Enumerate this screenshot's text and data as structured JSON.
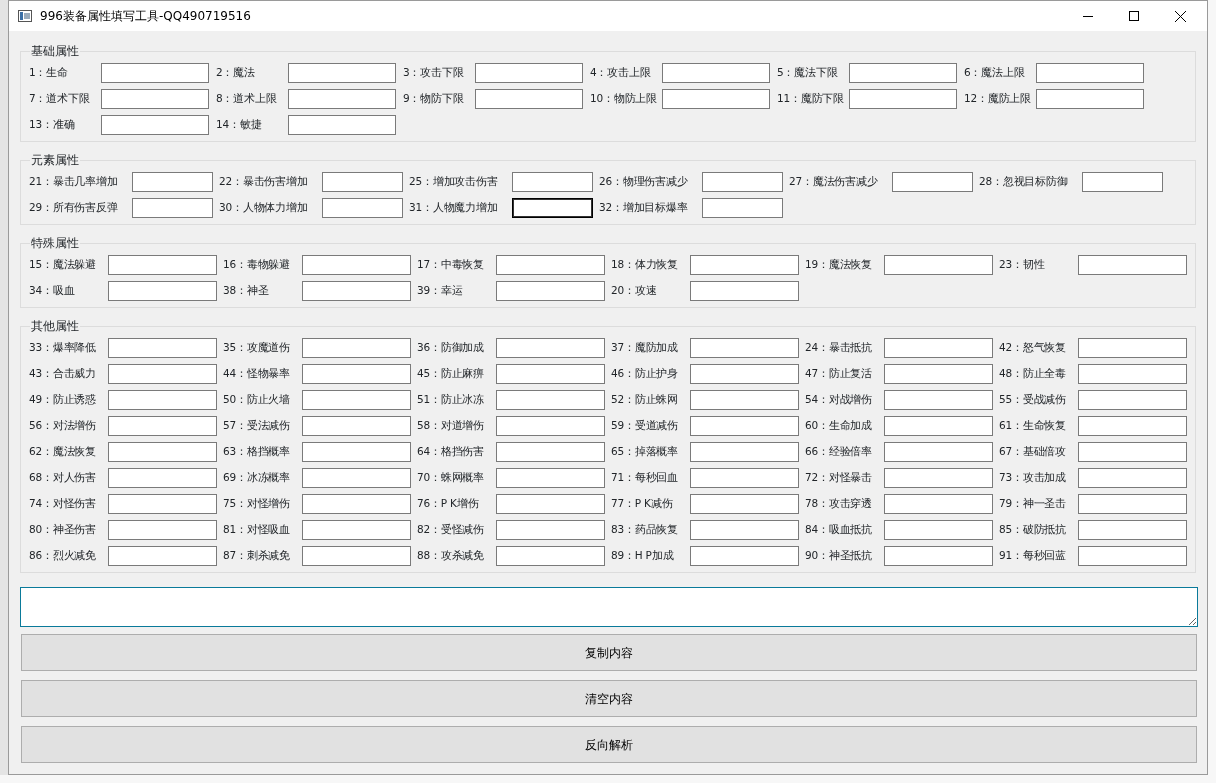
{
  "window": {
    "title": "996装备属性填写工具-QQ490719516"
  },
  "groups": [
    {
      "title": "基础属性",
      "fields": [
        {
          "label": "1：生命",
          "focused": false
        },
        {
          "label": "2：魔法",
          "focused": false
        },
        {
          "label": "3：攻击下限",
          "focused": false
        },
        {
          "label": "4：攻击上限",
          "focused": false
        },
        {
          "label": "5：魔法下限",
          "focused": false
        },
        {
          "label": "6：魔法上限",
          "focused": false
        },
        {
          "label": "7：道术下限",
          "focused": false
        },
        {
          "label": "8：道术上限",
          "focused": false
        },
        {
          "label": "9：物防下限",
          "focused": false
        },
        {
          "label": "10：物防上限",
          "focused": false
        },
        {
          "label": "11：魔防下限",
          "focused": false
        },
        {
          "label": "12：魔防上限",
          "focused": false
        },
        {
          "label": "13：准确",
          "focused": false
        },
        {
          "label": "14：敏捷",
          "focused": false
        }
      ]
    },
    {
      "title": "元素属性",
      "fields": [
        {
          "label": "21：暴击几率增加",
          "focused": false
        },
        {
          "label": "22：暴击伤害增加",
          "focused": false
        },
        {
          "label": "25：增加攻击伤害",
          "focused": false
        },
        {
          "label": "26：物理伤害减少",
          "focused": false
        },
        {
          "label": "27：魔法伤害减少",
          "focused": false
        },
        {
          "label": "28：忽视目标防御",
          "focused": false
        },
        {
          "label": "29：所有伤害反弹",
          "focused": false
        },
        {
          "label": "30：人物体力增加",
          "focused": false
        },
        {
          "label": "31：人物魔力增加",
          "focused": true
        },
        {
          "label": "32：增加目标爆率",
          "focused": false
        }
      ]
    },
    {
      "title": "特殊属性",
      "fields": [
        {
          "label": "15：魔法躲避",
          "focused": false
        },
        {
          "label": "16：毒物躲避",
          "focused": false
        },
        {
          "label": "17：中毒恢复",
          "focused": false
        },
        {
          "label": "18：体力恢复",
          "focused": false
        },
        {
          "label": "19：魔法恢复",
          "focused": false
        },
        {
          "label": "23：韧性",
          "focused": false
        },
        {
          "label": "34：吸血",
          "focused": false
        },
        {
          "label": "38：神圣",
          "focused": false
        },
        {
          "label": "39：幸运",
          "focused": false
        },
        {
          "label": "20：攻速",
          "focused": false
        }
      ]
    },
    {
      "title": "其他属性",
      "fields": [
        {
          "label": "33：爆率降低",
          "focused": false
        },
        {
          "label": "35：攻魔道伤",
          "focused": false
        },
        {
          "label": "36：防御加成",
          "focused": false
        },
        {
          "label": "37：魔防加成",
          "focused": false
        },
        {
          "label": "24：暴击抵抗",
          "focused": false
        },
        {
          "label": "42：怒气恢复",
          "focused": false
        },
        {
          "label": "43：合击威力",
          "focused": false
        },
        {
          "label": "44：怪物暴率",
          "focused": false
        },
        {
          "label": "45：防止麻痹",
          "focused": false
        },
        {
          "label": "46：防止护身",
          "focused": false
        },
        {
          "label": "47：防止复活",
          "focused": false
        },
        {
          "label": "48：防止全毒",
          "focused": false
        },
        {
          "label": "49：防止诱惑",
          "focused": false
        },
        {
          "label": "50：防止火墙",
          "focused": false
        },
        {
          "label": "51：防止冰冻",
          "focused": false
        },
        {
          "label": "52：防止蛛网",
          "focused": false
        },
        {
          "label": "54：对战增伤",
          "focused": false
        },
        {
          "label": "55：受战减伤",
          "focused": false
        },
        {
          "label": "56：对法增伤",
          "focused": false
        },
        {
          "label": "57：受法减伤",
          "focused": false
        },
        {
          "label": "58：对道增伤",
          "focused": false
        },
        {
          "label": "59：受道减伤",
          "focused": false
        },
        {
          "label": "60：生命加成",
          "focused": false
        },
        {
          "label": "61：生命恢复",
          "focused": false
        },
        {
          "label": "62：魔法恢复",
          "focused": false
        },
        {
          "label": "63：格挡概率",
          "focused": false
        },
        {
          "label": "64：格挡伤害",
          "focused": false
        },
        {
          "label": "65：掉落概率",
          "focused": false
        },
        {
          "label": "66：经验倍率",
          "focused": false
        },
        {
          "label": "67：基础倍攻",
          "focused": false
        },
        {
          "label": "68：对人伤害",
          "focused": false
        },
        {
          "label": "69：冰冻概率",
          "focused": false
        },
        {
          "label": "70：蛛网概率",
          "focused": false
        },
        {
          "label": "71：每秒回血",
          "focused": false
        },
        {
          "label": "72：对怪暴击",
          "focused": false
        },
        {
          "label": "73：攻击加成",
          "focused": false
        },
        {
          "label": "74：对怪伤害",
          "focused": false
        },
        {
          "label": "75：对怪增伤",
          "focused": false
        },
        {
          "label": "76：P K增伤",
          "focused": false
        },
        {
          "label": "77：P K减伤",
          "focused": false
        },
        {
          "label": "78：攻击穿透",
          "focused": false
        },
        {
          "label": "79：神一圣击",
          "focused": false
        },
        {
          "label": "80：神圣伤害",
          "focused": false
        },
        {
          "label": "81：对怪吸血",
          "focused": false
        },
        {
          "label": "82：受怪减伤",
          "focused": false
        },
        {
          "label": "83：药品恢复",
          "focused": false
        },
        {
          "label": "84：吸血抵抗",
          "focused": false
        },
        {
          "label": "85：破防抵抗",
          "focused": false
        },
        {
          "label": "86：烈火减免",
          "focused": false
        },
        {
          "label": "87：刺杀减免",
          "focused": false
        },
        {
          "label": "88：攻杀减免",
          "focused": false
        },
        {
          "label": "89：H P加成",
          "focused": false
        },
        {
          "label": "90：神圣抵抗",
          "focused": false
        },
        {
          "label": "91：每秒回蓝",
          "focused": false
        }
      ]
    }
  ],
  "output": {
    "focused": true
  },
  "buttons": [
    "复制内容",
    "清空内容",
    "反向解析"
  ]
}
